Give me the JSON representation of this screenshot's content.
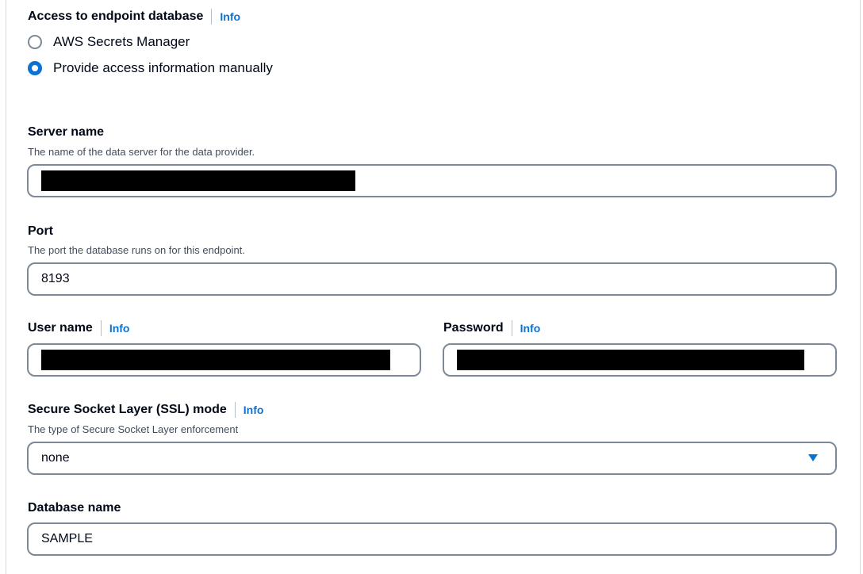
{
  "access": {
    "label": "Access to endpoint database",
    "info": "Info",
    "options": [
      {
        "label": "AWS Secrets Manager",
        "selected": false
      },
      {
        "label": "Provide access information manually",
        "selected": true
      }
    ]
  },
  "server": {
    "label": "Server name",
    "description": "The name of the data server for the data provider.",
    "value": ""
  },
  "port": {
    "label": "Port",
    "description": "The port the database runs on for this endpoint.",
    "value": "8193"
  },
  "username": {
    "label": "User name",
    "info": "Info",
    "value": ""
  },
  "password": {
    "label": "Password",
    "info": "Info",
    "value": ""
  },
  "ssl": {
    "label": "Secure Socket Layer (SSL) mode",
    "info": "Info",
    "description": "The type of Secure Socket Layer enforcement",
    "value": "none",
    "icon": "caret-down-icon"
  },
  "database": {
    "label": "Database name",
    "value": "SAMPLE"
  },
  "colors": {
    "accent": "#0972d3",
    "border": "#7d8998",
    "text": "#000716",
    "muted": "#414d5c"
  }
}
